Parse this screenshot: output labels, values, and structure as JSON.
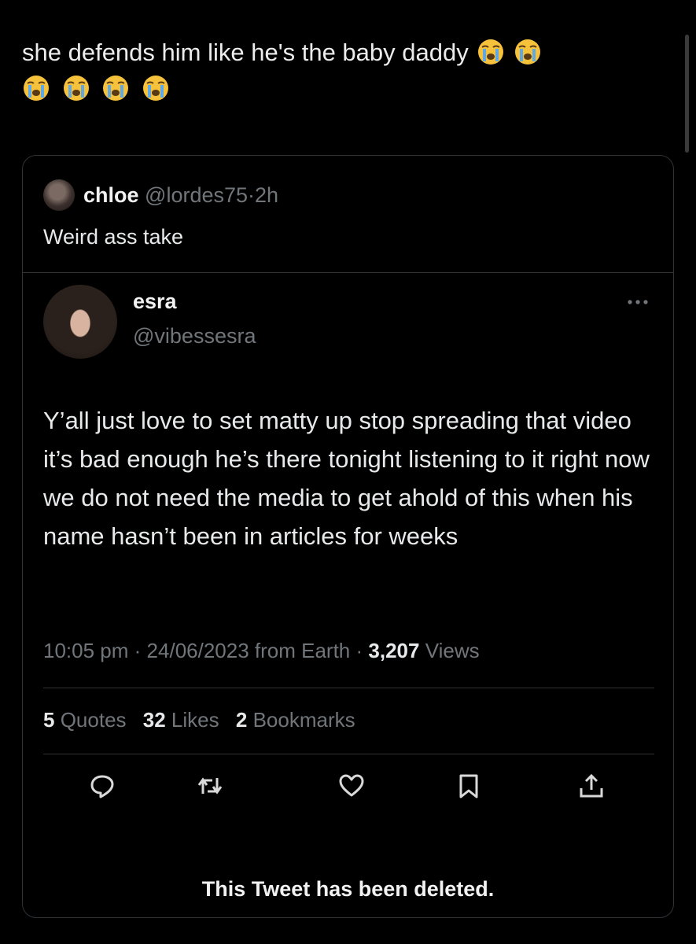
{
  "caption": {
    "text": "she defends him like he's the baby daddy",
    "emoji": "loudly-crying-face-emoji"
  },
  "quote": {
    "name": "chloe",
    "handle": "@lordes75",
    "separator": "·",
    "time": "2h",
    "text": "Weird ass take"
  },
  "tweet": {
    "name": "esra",
    "handle": "@vibessesra",
    "body": "Y’all just love to set matty up stop spreading that video it’s bad enough he’s there tonight listening to it right now we do not need the media to get ahold of this when his name hasn’t been in articles for weeks",
    "meta": {
      "time": "10:05 pm",
      "separator": "·",
      "date_source": "24/06/2023 from Earth",
      "views_count": "3,207",
      "views_label": "Views"
    },
    "stats": {
      "quotes_count": "5",
      "quotes_label": "Quotes",
      "likes_count": "32",
      "likes_label": "Likes",
      "bookmarks_count": "2",
      "bookmarks_label": "Bookmarks"
    },
    "actions": [
      "reply-icon",
      "retweet-icon",
      "like-icon",
      "bookmark-icon",
      "share-icon"
    ]
  },
  "deleted_notice": "This Tweet has been deleted.",
  "colors": {
    "background": "#000000",
    "text": "#e7e9ea",
    "muted": "#71767b",
    "border": "#2f3336",
    "emoji_yellow": "#f7c23b",
    "emoji_tears": "#5fa8e8"
  }
}
